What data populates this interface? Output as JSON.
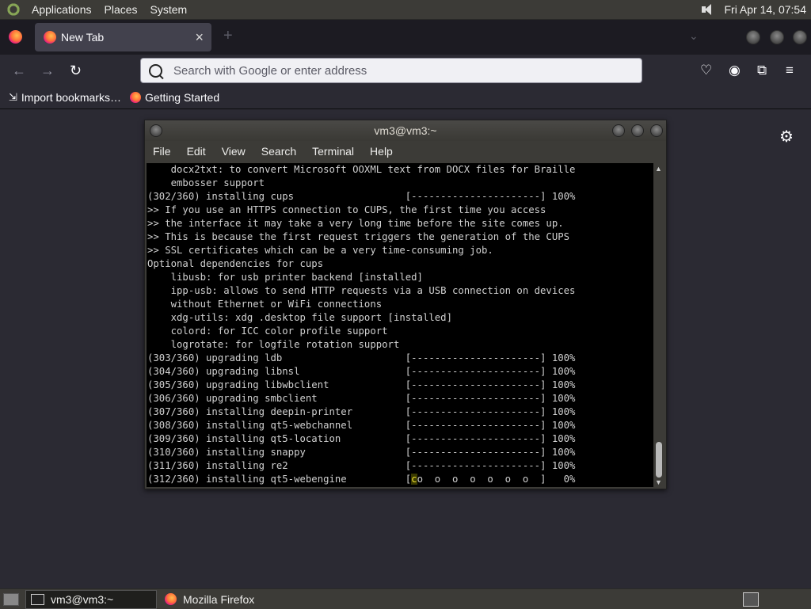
{
  "top_panel": {
    "menus": [
      "Applications",
      "Places",
      "System"
    ],
    "clock": "Fri Apr 14, 07:54"
  },
  "browser": {
    "tab_title": "New Tab",
    "url_placeholder": "Search with Google or enter address",
    "bookmarks": [
      "Import bookmarks…",
      "Getting Started"
    ]
  },
  "terminal": {
    "title": "vm3@vm3:~",
    "menus": [
      "File",
      "Edit",
      "View",
      "Search",
      "Terminal",
      "Help"
    ],
    "lines": [
      "    docx2txt: to convert Microsoft OOXML text from DOCX files for Braille",
      "    embosser support",
      "(302/360) installing cups                   [----------------------] 100%",
      ">> If you use an HTTPS connection to CUPS, the first time you access",
      ">> the interface it may take a very long time before the site comes up.",
      ">> This is because the first request triggers the generation of the CUPS",
      ">> SSL certificates which can be a very time-consuming job.",
      "Optional dependencies for cups",
      "    libusb: for usb printer backend [installed]",
      "    ipp-usb: allows to send HTTP requests via a USB connection on devices",
      "    without Ethernet or WiFi connections",
      "    xdg-utils: xdg .desktop file support [installed]",
      "    colord: for ICC color profile support",
      "    logrotate: for logfile rotation support",
      "(303/360) upgrading ldb                     [----------------------] 100%",
      "(304/360) upgrading libnsl                  [----------------------] 100%",
      "(305/360) upgrading libwbclient             [----------------------] 100%",
      "(306/360) upgrading smbclient               [----------------------] 100%",
      "(307/360) installing deepin-printer         [----------------------] 100%",
      "(308/360) installing qt5-webchannel         [----------------------] 100%",
      "(309/360) installing qt5-location           [----------------------] 100%",
      "(310/360) installing snappy                 [----------------------] 100%",
      "(311/360) installing re2                    [----------------------] 100%"
    ],
    "last_line_prefix": "(312/360) installing qt5-webengine          [",
    "last_line_cursor": "c",
    "last_line_suffix": "o  o  o  o  o  o  o  ]   0%"
  },
  "taskbar": {
    "items": [
      "vm3@vm3:~",
      "Mozilla Firefox"
    ]
  }
}
